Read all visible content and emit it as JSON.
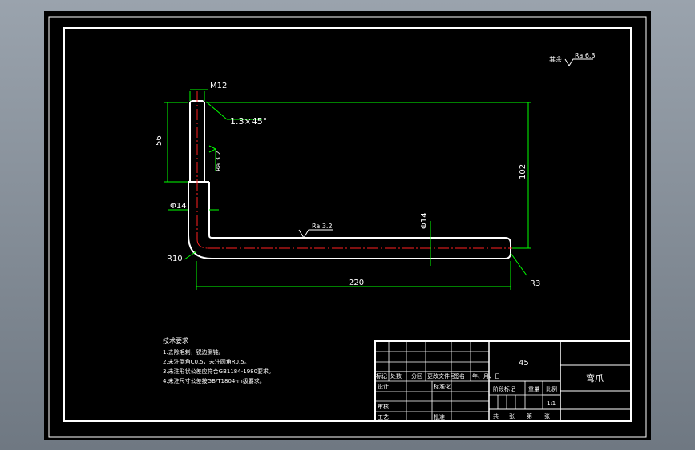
{
  "roughness": {
    "symbol_prefix": "其余",
    "rest": "Ra 6.3",
    "vertical_face": "Ra 3.2",
    "horizontal_face": "Ra 3.2"
  },
  "dimensions": {
    "thread": "M12",
    "chamfer": "1.3×45°",
    "length_56": "56",
    "height_102": "102",
    "diameter_left": "Φ14",
    "diameter_right": "Φ14",
    "radius_bend": "R10",
    "radius_end": "R3",
    "length_220": "220"
  },
  "tech_requirements": {
    "title": "技术要求",
    "items": [
      "1.去除毛刺，锐边倒钝。",
      "2.未注倒角C0.5，未注圆角R0.5。",
      "3.未注形状公差应符合GB1184-1980要求。",
      "4.未注尺寸公差按GB/T1804-m级要求。"
    ]
  },
  "title_block": {
    "material": "45",
    "part_name": "弯爪",
    "labels": {
      "mark": "标记",
      "count": "处数",
      "zone": "分区",
      "doc_no": "更改文件号",
      "sign": "签名",
      "date": "年、月、日",
      "design": "设计",
      "standardize": "标准化",
      "review": "审核",
      "process": "工艺",
      "approve": "批准",
      "stage_mark": "阶段标记",
      "weight": "重量",
      "scale": "比例",
      "scale_value": "1:1",
      "sheet_total": "共",
      "sheet_label": "张",
      "sheet_no": "第",
      "sheet_label2": "张"
    }
  }
}
